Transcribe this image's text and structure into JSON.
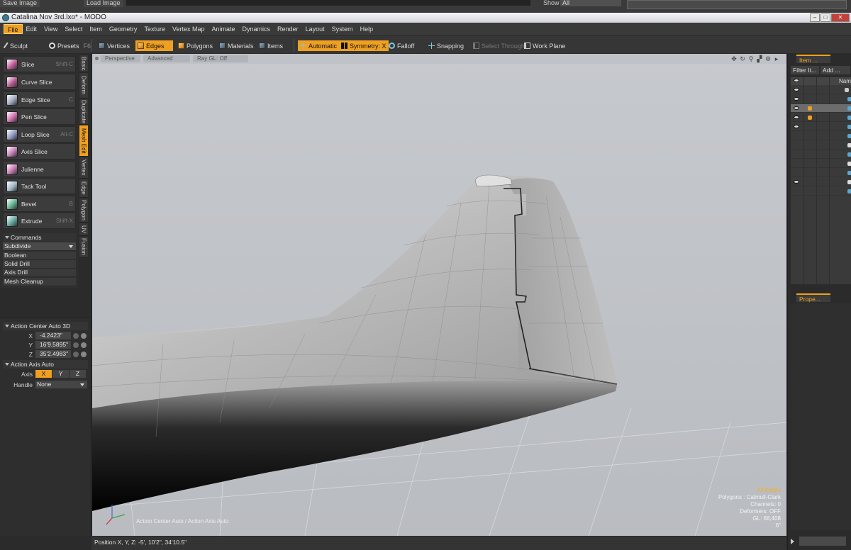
{
  "topstrip": {
    "save_image": "Save Image",
    "load_image": "Load Image",
    "show_label": "Show",
    "show_value": "All"
  },
  "window": {
    "title": "Catalina Nov 3rd.lxo* - MODO",
    "min": "–",
    "max": "□",
    "close": "✕"
  },
  "menu": [
    "File",
    "Edit",
    "View",
    "Select",
    "Item",
    "Geometry",
    "Texture",
    "Vertex Map",
    "Animate",
    "Dynamics",
    "Render",
    "Layout",
    "System",
    "Help"
  ],
  "toolbar": {
    "sculpt": "Sculpt",
    "presets": "Presets",
    "presets_key": "F6",
    "vertices": "Vertices",
    "edges": "Edges",
    "polygons": "Polygons",
    "materials": "Materials",
    "items": "Items",
    "automatic": "Automatic",
    "symmetry": "Symmetry: X",
    "falloff": "Falloff",
    "snapping": "Snapping",
    "select_through": "Select Through",
    "work_plane": "Work Plane"
  },
  "tools": [
    {
      "label": "Slice",
      "key": "Shift-C",
      "color": "#c05a9a"
    },
    {
      "label": "Curve Slice",
      "key": "",
      "color": "#b85890"
    },
    {
      "label": "Edge Slice",
      "key": "C",
      "color": "#a0a8c0"
    },
    {
      "label": "Pen Slice",
      "key": "",
      "color": "#d070b0"
    },
    {
      "label": "Loop Slice",
      "key": "Alt-C",
      "color": "#9098c0"
    },
    {
      "label": "Axis Slice",
      "key": "",
      "color": "#c880b8"
    },
    {
      "label": "Julienne",
      "key": "",
      "color": "#c878b0"
    },
    {
      "label": "Tack Tool",
      "key": "",
      "color": "#a0b8c8"
    },
    {
      "label": "Bevel",
      "key": "B",
      "color": "#60b090"
    },
    {
      "label": "Extrude",
      "key": "Shift-X",
      "color": "#60a8a0"
    }
  ],
  "commands": {
    "header": "Commands",
    "items": [
      "Subdivide",
      "Boolean",
      "Solid Drill",
      "Axis Drill",
      "Mesh Cleanup"
    ]
  },
  "vtabs": [
    "Basic",
    "Deform",
    "Duplicate",
    "Mesh Edit",
    "Vertex",
    "Edge",
    "Polygon",
    "UV",
    "Fusion"
  ],
  "action_center": {
    "header": "Action Center Auto 3D",
    "x_label": "X",
    "x": "-4.2423\"",
    "y_label": "Y",
    "y": "16'9.5895\"",
    "z_label": "Z",
    "z": "35'2.4983\""
  },
  "action_axis": {
    "header": "Action Axis Auto",
    "axis_label": "Axis",
    "x": "X",
    "y": "Y",
    "z": "Z",
    "handle_label": "Handle",
    "handle_value": "None"
  },
  "viewport": {
    "tabs": [
      "Perspective",
      "Advanced",
      "Ray GL: Off"
    ],
    "icons": [
      "✥",
      "↻",
      "⚲",
      "▞",
      "⚙",
      "▸"
    ],
    "info": {
      "selection": "All Edges",
      "polygons": "Polygons : Catmull-Clark",
      "channels": "Channels: 0",
      "deformers": "Deformers: OFF",
      "gl": "GL: 68,408",
      "units": "6\""
    },
    "action_msg": "Action Center Auto / Action Axis Auto"
  },
  "status": {
    "position": "Position X, Y, Z:  -5', 10'2\", 34'10.5\""
  },
  "right": {
    "item_tab": "Item ...",
    "filter": "Filter It...",
    "add": "Add ...",
    "name_col": "Name",
    "props_tab": "Prope..."
  }
}
